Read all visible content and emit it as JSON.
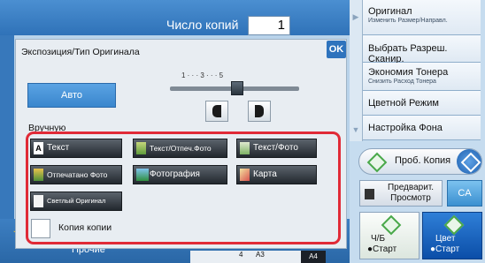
{
  "copies": {
    "label": "Число копий",
    "value": "1"
  },
  "right_panel": {
    "original": {
      "title": "Оригинал",
      "subtitle": "Изменить Размер/Направл."
    },
    "scan_resolution": "Выбрать Разреш. Сканир.",
    "toner_save": {
      "title": "Экономия Тонера",
      "subtitle": "Снизить Расход Тонера"
    },
    "color_mode": "Цветной Режим",
    "background": "Настройка Фона",
    "proof_copy": "Проб. Копия",
    "preview": "Предварит. Просмотр",
    "ca": "CA",
    "bw_start": {
      "line1": "Ч/Б",
      "line2": "Старт"
    },
    "color_start": {
      "line1": "Цвет",
      "line2": "Старт"
    }
  },
  "dialog": {
    "title": "Экспозиция/Тип Оригинала",
    "ok": "OK",
    "auto": "Авто",
    "manual": "Вручную",
    "scale": "1 · · · 3 · · · 5",
    "exposure_level": 3,
    "types": [
      {
        "label": "Текст",
        "icon": "text-icon"
      },
      {
        "label": "Текст/Отпеч.Фото",
        "icon": "text-printed-photo-icon"
      },
      {
        "label": "Текст/Фото",
        "icon": "text-photo-icon"
      },
      {
        "label": "Отпечатано Фото",
        "icon": "printed-photo-icon"
      },
      {
        "label": "Фотография",
        "icon": "photo-icon"
      },
      {
        "label": "Карта",
        "icon": "map-icon"
      },
      {
        "label": "Светлый Оригинал",
        "icon": "light-original-icon"
      }
    ],
    "copy_of_copy": "Копия копии"
  },
  "bottom": {
    "others": "Прочие",
    "paper_4": "4",
    "paper_a3": "A3",
    "paper_a4": "A4"
  },
  "colors": {
    "highlight_frame": "#e02a37",
    "auto_button": "#3a86cd",
    "ok_button": "#2e73bd"
  }
}
